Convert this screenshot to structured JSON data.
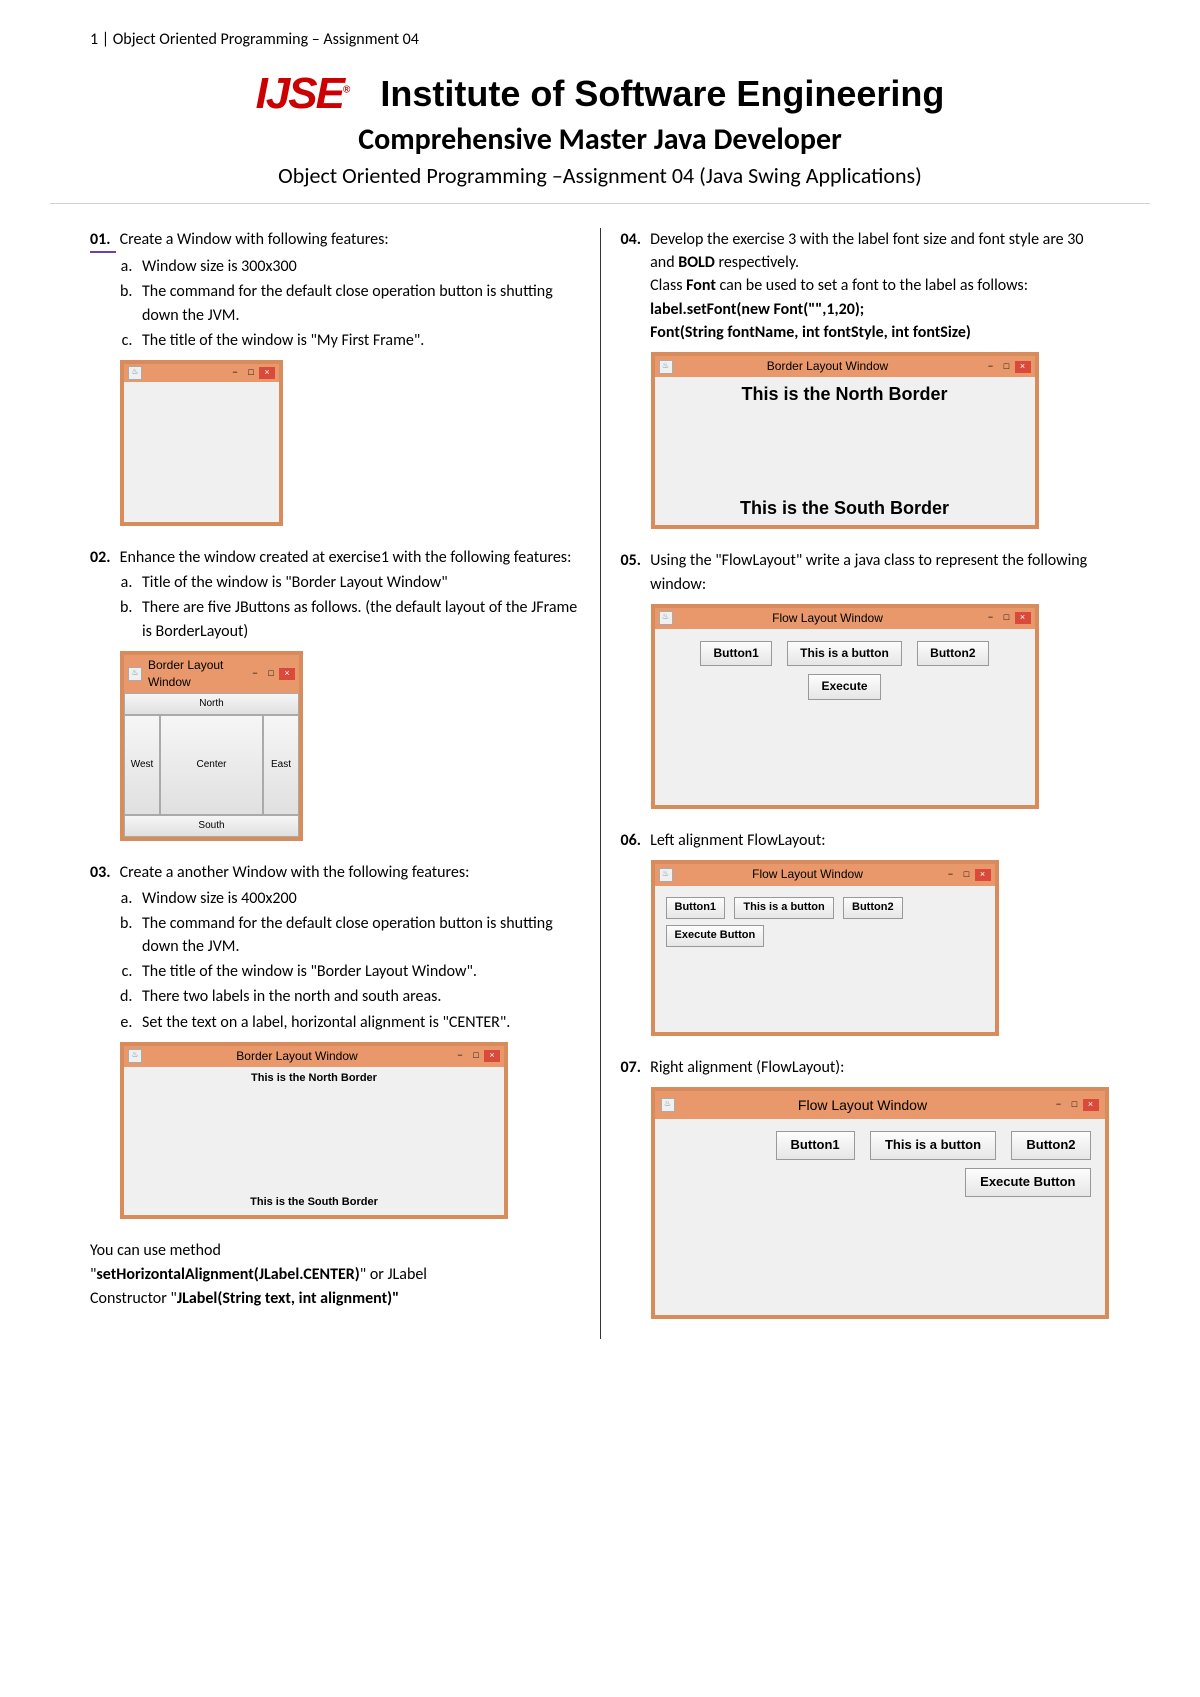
{
  "header": {
    "running": "1 | Object Oriented Programming – Assignment 04",
    "logo": "IJSE",
    "logo_reg": "®",
    "inst": "Institute of Software Engineering",
    "sub": "Comprehensive Master Java Developer",
    "course": "Object Oriented Programming –Assignment 04 (Java Swing Applications)"
  },
  "q1": {
    "num": "01.",
    "text": "Create  a Window with following features:",
    "a": "Window size is 300x300",
    "b": "The command for the default close operation button is shutting down the JVM.",
    "c": "The title of the window is \"My First Frame\"."
  },
  "q2": {
    "num": "02.",
    "text": "Enhance the window created at exercise1 with the following features:",
    "a": "Title of the window is \"Border Layout Window\"",
    "b": "There are five JButtons as follows. (the default layout of the JFrame is BorderLayout)"
  },
  "win2": {
    "title": "Border Layout Window",
    "north": "North",
    "south": "South",
    "east": "East",
    "west": "West",
    "center": "Center"
  },
  "q3": {
    "num": "03.",
    "text": "Create a another Window with the following features:",
    "a": "Window size is 400x200",
    "b": "The command for the default close operation button is shutting down the JVM.",
    "c": "The title of the window is \"Border Layout Window\".",
    "d": "There two labels in the north and south areas.",
    "e": "Set the text on a label, horizontal alignment is \"CENTER\"."
  },
  "win3": {
    "title": "Border Layout Window",
    "north": "This is the North Border",
    "south": "This is the South Border"
  },
  "q3_note": {
    "line1": "You can use method",
    "line2a": "\"",
    "line2b": "setHorizontalAlignment(JLabel.CENTER)",
    "line2c": "\" or JLabel",
    "line3a": "Constructor \"",
    "line3b": "JLabel(String text, int alignment)\""
  },
  "q4": {
    "num": "04.",
    "text_a": "Develop the exercise 3 with the label font size and font style are 30 and ",
    "text_bold_a": "BOLD",
    "text_b": " respectively.",
    "text_c": "Class ",
    "text_bold_b": "Font",
    "text_d": " can be used to set a font to the label as follows:",
    "code1": "label.setFont(new Font(\"\",1,20);",
    "code2": "Font(String fontName, int fontStyle, int fontSize)"
  },
  "win4": {
    "title": "Border Layout Window",
    "north": "This is the North Border",
    "south": "This is the South Border"
  },
  "q5": {
    "num": "05.",
    "text": "Using the \"FlowLayout\" write a java class to represent the following window:"
  },
  "win5": {
    "title": "Flow Layout Window",
    "b1": "Button1",
    "b2": "This is a button",
    "b3": "Button2",
    "b4": "Execute"
  },
  "q6": {
    "num": "06.",
    "text": "Left alignment FlowLayout:"
  },
  "win6": {
    "title": "Flow Layout Window",
    "b1": "Button1",
    "b2": "This is a button",
    "b3": "Button2",
    "b4": "Execute Button"
  },
  "q7": {
    "num": "07.",
    "text": "Right alignment (FlowLayout):"
  },
  "win7": {
    "title": "Flow Layout Window",
    "b1": "Button1",
    "b2": "This is a button",
    "b3": "Button2",
    "b4": "Execute Button"
  },
  "sym": {
    "min": "−",
    "max": "□",
    "close": "×"
  }
}
